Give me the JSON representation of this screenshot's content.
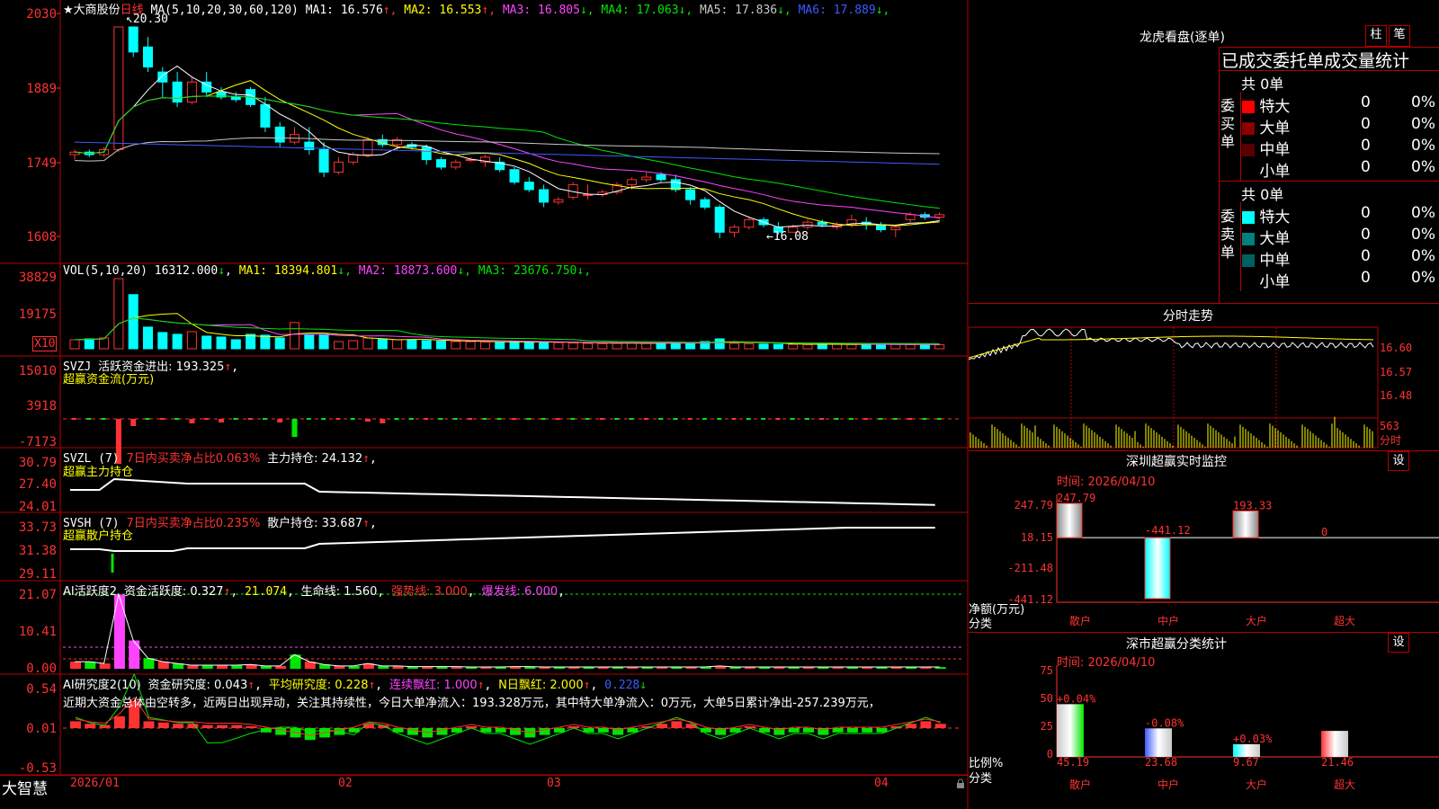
{
  "stock": {
    "name": "★大商股份",
    "period": "日线"
  },
  "kline": {
    "ma_label": "MA(5,10,20,30,60,120)",
    "ma": [
      {
        "t": "MA1: 16.576",
        "a": "↑",
        "c": "#ffffff"
      },
      {
        "t": "MA2: 16.553",
        "a": "↑",
        "c": "#ffff00"
      },
      {
        "t": "MA3: 16.805",
        "a": "↓",
        "c": "#ff44ff"
      },
      {
        "t": "MA4: 17.063",
        "a": "↓",
        "c": "#00e600"
      },
      {
        "t": "MA5: 17.836",
        "a": "↓",
        "c": "#c8c8c8"
      },
      {
        "t": "MA6: 17.889",
        "a": "↓",
        "c": "#3c5aff"
      }
    ],
    "yticks": [
      "2030",
      "1889",
      "1749",
      "1608"
    ],
    "high": "20.30",
    "low": "16.08",
    "ohlc": [
      [
        17.75,
        17.85,
        17.65,
        17.8
      ],
      [
        17.8,
        17.85,
        17.7,
        17.75
      ],
      [
        17.75,
        17.9,
        17.7,
        17.85
      ],
      [
        17.85,
        20.3,
        17.8,
        20.3
      ],
      [
        20.3,
        20.3,
        19.7,
        19.8
      ],
      [
        19.9,
        20.1,
        19.4,
        19.5
      ],
      [
        19.4,
        19.5,
        18.9,
        19.2
      ],
      [
        19.2,
        19.4,
        18.7,
        18.8
      ],
      [
        18.8,
        19.3,
        18.75,
        19.2
      ],
      [
        19.2,
        19.4,
        18.9,
        19.0
      ],
      [
        19.0,
        19.1,
        18.85,
        18.9
      ],
      [
        18.9,
        19.0,
        18.8,
        18.85
      ],
      [
        19.05,
        19.1,
        18.7,
        18.75
      ],
      [
        18.75,
        18.9,
        18.2,
        18.3
      ],
      [
        18.3,
        18.4,
        17.9,
        18.0
      ],
      [
        18.0,
        18.3,
        17.95,
        18.15
      ],
      [
        18.0,
        18.3,
        17.75,
        17.85
      ],
      [
        17.85,
        18.0,
        17.3,
        17.4
      ],
      [
        17.4,
        17.7,
        17.35,
        17.6
      ],
      [
        17.6,
        17.8,
        17.55,
        17.75
      ],
      [
        17.75,
        18.1,
        17.7,
        18.05
      ],
      [
        18.05,
        18.15,
        17.9,
        17.95
      ],
      [
        17.95,
        18.1,
        17.85,
        18.05
      ],
      [
        17.95,
        18.0,
        17.85,
        17.9
      ],
      [
        17.9,
        17.95,
        17.55,
        17.65
      ],
      [
        17.65,
        17.7,
        17.45,
        17.5
      ],
      [
        17.5,
        17.65,
        17.45,
        17.6
      ],
      [
        17.65,
        17.7,
        17.6,
        17.65
      ],
      [
        17.6,
        17.75,
        17.5,
        17.7
      ],
      [
        17.6,
        17.7,
        17.4,
        17.45
      ],
      [
        17.45,
        17.5,
        17.15,
        17.2
      ],
      [
        17.2,
        17.3,
        17.0,
        17.05
      ],
      [
        17.05,
        17.15,
        16.7,
        16.8
      ],
      [
        16.8,
        16.9,
        16.75,
        16.85
      ],
      [
        16.9,
        17.2,
        16.85,
        17.15
      ],
      [
        16.95,
        17.15,
        16.85,
        16.95
      ],
      [
        16.95,
        17.05,
        16.9,
        17.0
      ],
      [
        17.0,
        17.2,
        16.95,
        17.15
      ],
      [
        17.15,
        17.3,
        17.05,
        17.25
      ],
      [
        17.25,
        17.4,
        17.2,
        17.3
      ],
      [
        17.35,
        17.4,
        17.2,
        17.25
      ],
      [
        17.25,
        17.35,
        17.0,
        17.05
      ],
      [
        17.05,
        17.1,
        16.75,
        16.85
      ],
      [
        16.85,
        16.9,
        16.65,
        16.7
      ],
      [
        16.7,
        16.75,
        16.08,
        16.2
      ],
      [
        16.2,
        16.35,
        16.1,
        16.3
      ],
      [
        16.3,
        16.5,
        16.25,
        16.45
      ],
      [
        16.45,
        16.5,
        16.3,
        16.35
      ],
      [
        16.3,
        16.4,
        16.15,
        16.2
      ],
      [
        16.2,
        16.35,
        16.2,
        16.3
      ],
      [
        16.3,
        16.45,
        16.25,
        16.4
      ],
      [
        16.4,
        16.45,
        16.3,
        16.35
      ],
      [
        16.3,
        16.4,
        16.25,
        16.35
      ],
      [
        16.35,
        16.55,
        16.3,
        16.45
      ],
      [
        16.4,
        16.5,
        16.25,
        16.35
      ],
      [
        16.35,
        16.4,
        16.2,
        16.25
      ],
      [
        16.25,
        16.35,
        16.1,
        16.3
      ],
      [
        16.45,
        16.6,
        16.4,
        16.55
      ],
      [
        16.55,
        16.6,
        16.45,
        16.5
      ],
      [
        16.5,
        16.6,
        16.45,
        16.55
      ]
    ],
    "ylim": [
      16.08,
      20.3
    ]
  },
  "vol": {
    "label": "VOL(5,10,20)",
    "cur": "16312.000",
    "cur_a": "↓",
    "ma": [
      {
        "t": "MA1: 18394.801",
        "a": "↓",
        "c": "#ffff00"
      },
      {
        "t": "MA2: 18873.600",
        "a": "↓",
        "c": "#ff44ff"
      },
      {
        "t": "MA3: 23676.750",
        "a": "↓",
        "c": "#00e600"
      }
    ],
    "yticks": [
      "38829",
      "19175"
    ],
    "unit": "X10",
    "values": [
      5000,
      5500,
      6000,
      38829,
      30000,
      12000,
      9000,
      8000,
      9500,
      7000,
      6500,
      5000,
      8000,
      7500,
      6000,
      14500,
      7500,
      8000,
      4000,
      4500,
      6000,
      5500,
      5000,
      4800,
      4500,
      4200,
      4000,
      3900,
      3800,
      3500,
      4000,
      3800,
      3600,
      3400,
      3200,
      3000,
      2900,
      3100,
      3300,
      3000,
      2800,
      3500,
      3200,
      4000,
      5500,
      3000,
      2800,
      2600,
      2500,
      2400,
      2300,
      2600,
      2500,
      2400,
      2300,
      2500,
      2400,
      2300,
      2400,
      2200
    ]
  },
  "svzj": {
    "label": "SVZJ",
    "t1": "活跃资金进出: 193.325",
    "a1": "↑",
    "sub": "超赢资金流(万元)",
    "yticks": [
      "15010",
      "3918",
      "-7173"
    ]
  },
  "svzl": {
    "label": "SVZL (7)",
    "t1": "7日内买卖净占比0.063%",
    "t2": "主力持仓: 24.132",
    "a2": "↑",
    "sub": "超赢主力持仓",
    "yticks": [
      "30.79",
      "27.40",
      "24.01"
    ]
  },
  "svsh": {
    "label": "SVSH (7)",
    "t1": "7日内买卖净占比0.235%",
    "t2": "散户持仓: 33.687",
    "a2": "↑",
    "sub": "超赢散户持仓",
    "yticks": [
      "33.73",
      "31.38",
      "29.11"
    ]
  },
  "ai1": {
    "label": "AI活跃度2",
    "t1": "资金活跃度: 0.327",
    "a1": "↑",
    "t2": "21.074",
    "t3": "生命线: 1.560",
    "t4": "强势线: 3.000",
    "t5": "爆发线: 6.000",
    "yticks": [
      "21.07",
      "10.41",
      "0.00"
    ]
  },
  "ai2": {
    "label": "AI研究度2(10)",
    "t1": "资金研究度: 0.043",
    "a1": "↑",
    "t2": "平均研究度: 0.228",
    "a2": "↑",
    "t3": "连续飘红: 1.000",
    "a3": "↑",
    "t4": "N日飘红: 2.000",
    "a4": "↑",
    "t5": "0.228",
    "a5": "↓",
    "note": "近期大资金总体由空转多，近两日出现异动，关注其持续性，今日大单净流入：193.328万元，其中特大单净流入：0万元，大单5日累计净出-257.239万元，",
    "yticks": [
      "0.54",
      "0.01",
      "-0.53"
    ]
  },
  "xaxis": {
    "brand": "大智慧",
    "labels": [
      "2026/01",
      "02",
      "03",
      "04"
    ]
  },
  "right": {
    "dragon_title": "龙虎看盘(逐单)",
    "btn_zhu": "柱",
    "btn_bi": "笔",
    "stats_title": "已成交委托单成交量统计",
    "buy": {
      "side": "委买单",
      "total": "共 0单",
      "rows": [
        {
          "n": "特大",
          "v": "0",
          "p": "0%",
          "c": "#ff0000"
        },
        {
          "n": "大单",
          "v": "0",
          "p": "0%",
          "c": "#8b0000"
        },
        {
          "n": "中单",
          "v": "0",
          "p": "0%",
          "c": "#5a0000"
        },
        {
          "n": "小单",
          "v": "0",
          "p": "0%",
          "c": "#000000"
        }
      ]
    },
    "sell": {
      "side": "委卖单",
      "total": "共 0单",
      "rows": [
        {
          "n": "特大",
          "v": "0",
          "p": "0%",
          "c": "#00ffff"
        },
        {
          "n": "大单",
          "v": "0",
          "p": "0%",
          "c": "#008080"
        },
        {
          "n": "中单",
          "v": "0",
          "p": "0%",
          "c": "#006060"
        },
        {
          "n": "小单",
          "v": "0",
          "p": "0%",
          "c": "#000000"
        }
      ]
    },
    "intraday": {
      "title": "分时走势",
      "yticks": [
        "16.60",
        "16.57",
        "16.48"
      ],
      "vol": "563",
      "unit": "分时"
    },
    "monitor": {
      "title": "深圳超赢实时监控",
      "btn": "设",
      "time": "时间: 2026/04/10",
      "yticks": [
        "247.79",
        "18.15",
        "-211.48",
        "-441.12"
      ],
      "ylabel": "净额(万元)",
      "xlabel": "分类",
      "cats": [
        "散户",
        "中户",
        "大户",
        "超大"
      ],
      "values": [
        247.79,
        -441.12,
        193.33,
        0
      ],
      "labels": [
        "247.79",
        "-441.12",
        "193.33",
        "0"
      ]
    },
    "classify": {
      "title": "深市超赢分类统计",
      "btn": "设",
      "time": "时间: 2026/04/10",
      "yticks": [
        "75",
        "50",
        "25",
        "0"
      ],
      "ylabel": "比例%",
      "xlabel": "分类",
      "cats": [
        "散户",
        "中户",
        "大户",
        "超大"
      ],
      "values": [
        45.19,
        23.68,
        9.67,
        21.46
      ],
      "chg": [
        "+0.04%",
        "-0.08%",
        "+0.03%",
        ""
      ]
    }
  }
}
